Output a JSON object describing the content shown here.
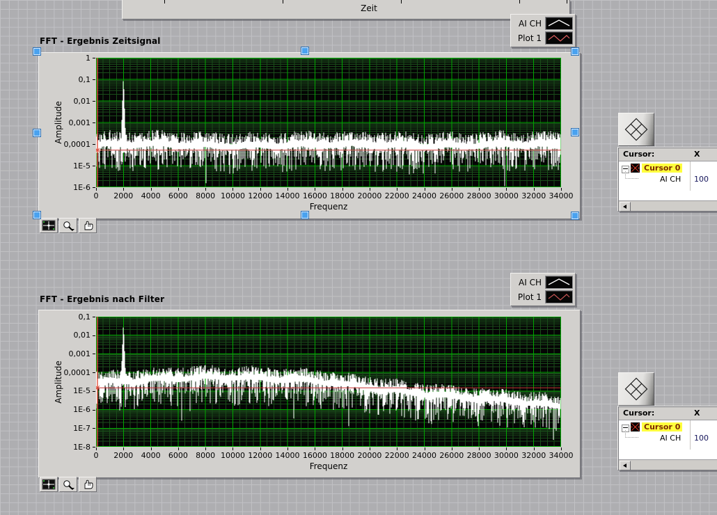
{
  "window": {
    "background_color": "#aeaeb1"
  },
  "top_graph": {
    "xlabel": "Zeit"
  },
  "graph1": {
    "title": "FFT - Ergebnis Zeitsignal",
    "ylabel": "Amplitude",
    "xlabel": "Frequenz",
    "y_ticks": [
      "1",
      "0,1",
      "0,01",
      "0,001",
      "0,0001",
      "1E-5",
      "1E-6"
    ],
    "x_ticks": [
      "0",
      "2000",
      "4000",
      "6000",
      "8000",
      "10000",
      "12000",
      "14000",
      "16000",
      "18000",
      "20000",
      "22000",
      "24000",
      "26000",
      "28000",
      "30000",
      "32000",
      "34000"
    ],
    "legend": [
      {
        "label": "AI CH",
        "line_color": "#ffffff"
      },
      {
        "label": "Plot 1",
        "line_color": "#e06060"
      }
    ],
    "cursor_panel": {
      "header_cursor": "Cursor:",
      "header_x": "X",
      "cursor_name": "Cursor 0",
      "channel": "AI CH",
      "x_value": "100"
    }
  },
  "graph2": {
    "title": "FFT - Ergebnis nach Filter",
    "ylabel": "Amplitude",
    "xlabel": "Frequenz",
    "y_ticks": [
      "0,1",
      "0,01",
      "0,001",
      "0,0001",
      "1E-5",
      "1E-6",
      "1E-7",
      "1E-8"
    ],
    "x_ticks": [
      "0",
      "2000",
      "4000",
      "6000",
      "8000",
      "10000",
      "12000",
      "14000",
      "16000",
      "18000",
      "20000",
      "22000",
      "24000",
      "26000",
      "28000",
      "30000",
      "32000",
      "34000"
    ],
    "legend": [
      {
        "label": "AI CH",
        "line_color": "#ffffff"
      },
      {
        "label": "Plot 1",
        "line_color": "#c65555"
      }
    ],
    "cursor_panel": {
      "header_cursor": "Cursor:",
      "header_x": "X",
      "cursor_name": "Cursor 0",
      "channel": "AI CH",
      "x_value": "100"
    }
  },
  "chart_data": [
    {
      "type": "line",
      "title": "FFT - Ergebnis Zeitsignal",
      "xlabel": "Frequenz",
      "ylabel": "Amplitude",
      "x_range": [
        0,
        34000
      ],
      "x_major_step": 2000,
      "x_minor_step": 500,
      "y_scale": "log",
      "y_range": [
        1e-06,
        1
      ],
      "plot_bg": "#050505",
      "grid_major_color": "#00a800",
      "grid_minor_color": "#1a4d1a",
      "legend_position": "top-right-outside",
      "series": [
        {
          "name": "AI CH",
          "color": "#ffffff",
          "kind": "noise-spectrum",
          "description": "broadband white-noise floor near 1e-4 with random dips to ~5e-6 and a dominant tone",
          "noise_floor": 0.0001,
          "peak": {
            "x": 2000,
            "y": 0.15
          }
        },
        {
          "name": "Plot 1",
          "color": "#c83232",
          "kind": "constant",
          "constant_y": 5.2e-05
        }
      ],
      "cursor": {
        "name": "Cursor 0",
        "x": 100,
        "color": "#e0503c"
      },
      "synth": {
        "seed": 20107,
        "center_log": -4.05,
        "top_jitter": 0.5,
        "bottom_jitter": 1.15,
        "deep_dip_probability": 0.035,
        "deep_dip_extra": 1.0,
        "peak_log": -0.82,
        "wobble": 0.06
      }
    },
    {
      "type": "line",
      "title": "FFT - Ergebnis nach Filter",
      "xlabel": "Frequenz",
      "ylabel": "Amplitude",
      "x_range": [
        0,
        34000
      ],
      "x_major_step": 2000,
      "x_minor_step": 500,
      "y_scale": "log",
      "y_range": [
        1e-08,
        0.1
      ],
      "plot_bg": "#050505",
      "grid_major_color": "#00a800",
      "grid_minor_color": "#1a4d1a",
      "legend_position": "top-right-outside",
      "series": [
        {
          "name": "AI CH",
          "color": "#ffffff",
          "kind": "noise-spectrum",
          "description": "noise floor ~3e-5 up to ~16 kHz with slight hump near 10 kHz, rolling off to ~2e-6 at 34 kHz; tone at 2 kHz",
          "noise_floor": 3e-05,
          "peak": {
            "x": 2000,
            "y": 0.05
          },
          "rolloff": {
            "start_hz": 16000,
            "end_hz": 34000
          }
        },
        {
          "name": "Plot 1",
          "color": "#c83232",
          "kind": "constant",
          "constant_y": 1.5e-05
        }
      ],
      "cursor": {
        "name": "Cursor 0",
        "x": 100,
        "color": "#e0503c"
      },
      "synth": {
        "seed": 8821,
        "center_log": -4.55,
        "hump_amp": 0.33,
        "hump_mu": 9500,
        "hump_sigma": 5200,
        "rolloff_start": 16000,
        "rolloff_end": 34000,
        "rolloff_drop": 1.3,
        "top_jitter": 0.5,
        "bottom_jitter": 1.35,
        "deep_dip_probability": 0.05,
        "deep_dip_extra": 1.2,
        "peak_log": -1.32,
        "wobble": 0.06
      }
    }
  ]
}
